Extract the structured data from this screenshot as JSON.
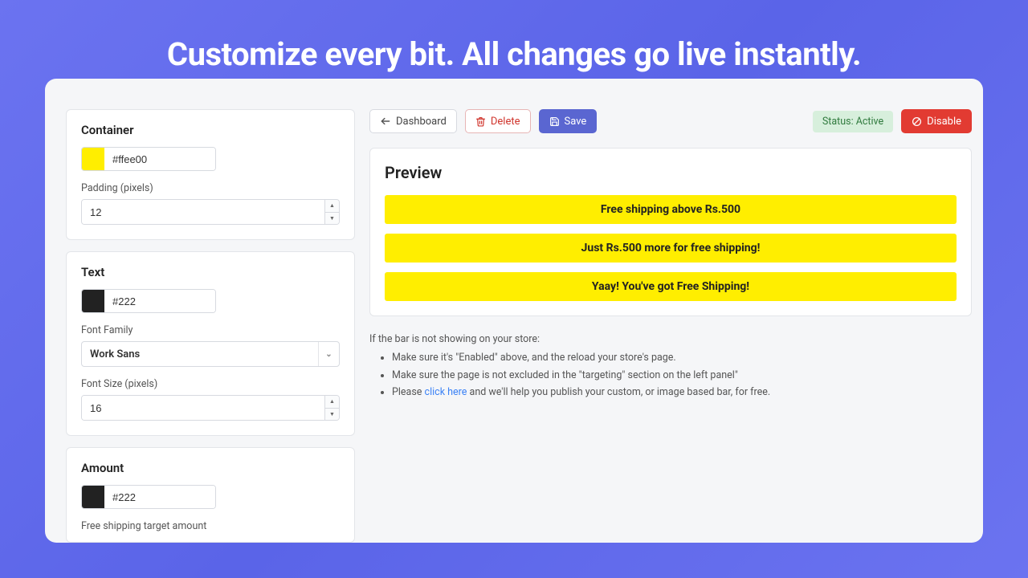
{
  "hero": {
    "title": "Customize every bit. All changes go live instantly."
  },
  "toolbar": {
    "dashboard": "Dashboard",
    "delete": "Delete",
    "save": "Save",
    "status": "Status: Active",
    "disable": "Disable"
  },
  "container": {
    "title": "Container",
    "color": "#ffee00",
    "swatch": "#ffee00",
    "padding_label": "Padding (pixels)",
    "padding_value": "12"
  },
  "text": {
    "title": "Text",
    "color": "#222",
    "swatch": "#222222",
    "font_family_label": "Font Family",
    "font_family_value": "Work Sans",
    "font_size_label": "Font Size (pixels)",
    "font_size_value": "16"
  },
  "amount": {
    "title": "Amount",
    "color": "#222",
    "swatch": "#222222",
    "target_label": "Free shipping target amount"
  },
  "preview": {
    "title": "Preview",
    "bars": [
      "Free shipping above Rs.500",
      "Just Rs.500 more for free shipping!",
      "Yaay! You've got Free Shipping!"
    ]
  },
  "help": {
    "intro": "If the bar is not showing on your store:",
    "items_pre": [
      "Make sure it's \"Enabled\" above, and the reload your store's page.",
      "Make sure the page is not excluded in the \"targeting\" section on the left panel\""
    ],
    "please": "Please ",
    "link": "click here",
    "after": " and we'll help you publish your custom, or image based bar, for free."
  }
}
